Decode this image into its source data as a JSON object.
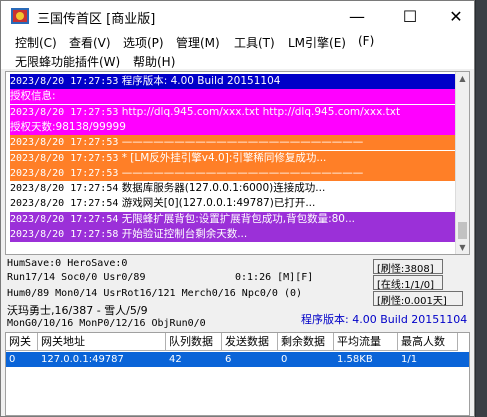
{
  "window": {
    "title": "三国传首区 [商业版]",
    "minimize": "—",
    "maximize": "☐",
    "close": "✕"
  },
  "menu": [
    "控制(C)",
    "查看(V)",
    "选项(P)",
    "管理(M)",
    "工具(T)",
    "LM引擎(E)",
    "(F)",
    "无限蜂功能插件(W)",
    "帮助(H)"
  ],
  "log": [
    {
      "ts": "2023/8/20 17:27:53",
      "text": "程序版本: 4.00 Build 20151104",
      "bg": "#0000c8",
      "fg": "#ffffff"
    },
    {
      "ts": "",
      "text": "授权信息:",
      "bg": "#ff00ff",
      "fg": "#ffffff"
    },
    {
      "ts": "2023/8/20 17:27:53",
      "text": "http://dlq.945.com/xxx.txt http://dlq.945.com/xxx.txt",
      "bg": "#ff00ff",
      "fg": "#ffffff"
    },
    {
      "ts": "",
      "text": "授权天数:98138/99999",
      "bg": "#ff00ff",
      "fg": "#ffffff"
    },
    {
      "ts": "2023/8/20 17:27:53",
      "text": "———————————————————————",
      "bg": "#ff7f27",
      "fg": "#ffffff"
    },
    {
      "ts": "2023/8/20 17:27:53",
      "text": "* [LM反外挂引擎v4.0]:引擎稀同修复成功...",
      "bg": "#ff7f27",
      "fg": "#ffffff"
    },
    {
      "ts": "2023/8/20 17:27:53",
      "text": "———————————————————————",
      "bg": "#ff7f27",
      "fg": "#ffffff"
    },
    {
      "ts": "2023/8/20 17:27:54",
      "text": "数据库服务器(127.0.0.1:6000)连接成功...",
      "bg": "#ffffff",
      "fg": "#000000"
    },
    {
      "ts": "2023/8/20 17:27:54",
      "text": "游戏网关[0](127.0.0.1:49787)已打开...",
      "bg": "#ffffff",
      "fg": "#000000"
    },
    {
      "ts": "2023/8/20 17:27:54",
      "text": "无限蜂扩展背包:设置扩展背包成功,背包数量:80...",
      "bg": "#9b30d8",
      "fg": "#ffffff"
    },
    {
      "ts": "2023/8/20 17:27:58",
      "text": "开始验证控制台剩余天数...",
      "bg": "#9b30d8",
      "fg": "#ffffff"
    }
  ],
  "status": {
    "hum_save": "HumSave:0 HeroSave:0",
    "run": "Run17/14 Soc0/0 Usr0/89",
    "timer": "0:1:26 [M][F]",
    "refresh": "[刷怪:3808]",
    "hum": "Hum0/89 Mon0/14 UsrRot16/121 Merch0/16 Npc0/0 (0)",
    "online": "[在线:1/1/0]",
    "warrior": "沃玛勇士,16/387 - 雪人/5/9",
    "refresh_interval": "[刷怪:0.001天]",
    "mon": "MonG0/10/16 MonP0/12/16 ObjRun0/0",
    "version": "程序版本: 4.00 Build 20151104"
  },
  "table": {
    "headers": [
      "网关",
      "网关地址",
      "队列数据",
      "发送数据",
      "剩余数据",
      "平均流量",
      "最高人数"
    ],
    "rows": [
      [
        "0",
        "127.0.0.1:49787",
        "42",
        "6",
        "0",
        "1.58KB",
        "1/1"
      ]
    ]
  }
}
